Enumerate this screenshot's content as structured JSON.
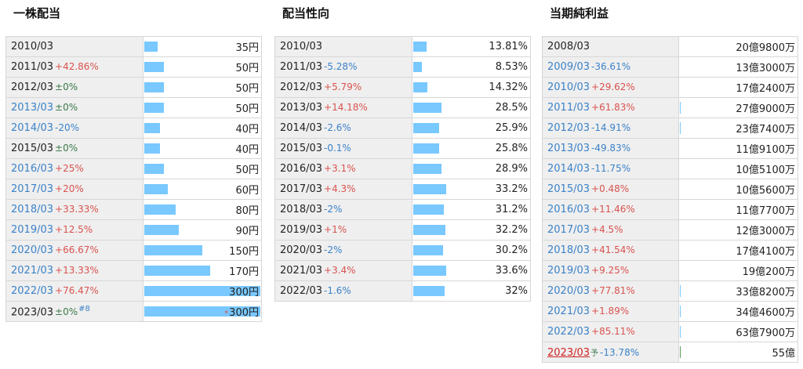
{
  "dividend": {
    "title": "一株配当",
    "rows": [
      {
        "year": "2010/03",
        "change": "",
        "dir": "",
        "value": "35円",
        "fill": 0.117,
        "link": false
      },
      {
        "year": "2011/03",
        "change": "+42.86%",
        "dir": "up",
        "value": "50円",
        "fill": 0.167,
        "link": false
      },
      {
        "year": "2012/03",
        "change": "±0%",
        "dir": "flat",
        "value": "50円",
        "fill": 0.167,
        "link": false
      },
      {
        "year": "2013/03",
        "change": "±0%",
        "dir": "flat",
        "value": "50円",
        "fill": 0.167,
        "link": true
      },
      {
        "year": "2014/03",
        "change": "-20%",
        "dir": "down",
        "value": "40円",
        "fill": 0.133,
        "link": true
      },
      {
        "year": "2015/03",
        "change": "±0%",
        "dir": "flat",
        "value": "40円",
        "fill": 0.133,
        "link": false
      },
      {
        "year": "2016/03",
        "change": "+25%",
        "dir": "up",
        "value": "50円",
        "fill": 0.167,
        "link": true
      },
      {
        "year": "2017/03",
        "change": "+20%",
        "dir": "up",
        "value": "60円",
        "fill": 0.2,
        "link": true
      },
      {
        "year": "2018/03",
        "change": "+33.33%",
        "dir": "up",
        "value": "80円",
        "fill": 0.267,
        "link": true
      },
      {
        "year": "2019/03",
        "change": "+12.5%",
        "dir": "up",
        "value": "90円",
        "fill": 0.3,
        "link": true
      },
      {
        "year": "2020/03",
        "change": "+66.67%",
        "dir": "up",
        "value": "150円",
        "fill": 0.5,
        "link": true
      },
      {
        "year": "2021/03",
        "change": "+13.33%",
        "dir": "up",
        "value": "170円",
        "fill": 0.567,
        "link": true
      },
      {
        "year": "2022/03",
        "change": "+76.47%",
        "dir": "up",
        "value": "300円",
        "fill": 1.0,
        "link": true
      },
      {
        "year": "2023/03",
        "change": "±0%",
        "dir": "flat",
        "value": "300円",
        "fill": 1.0,
        "link": false,
        "note": "#8",
        "asterisk": "*"
      }
    ]
  },
  "payout": {
    "title": "配当性向",
    "rows": [
      {
        "year": "2010/03",
        "change": "",
        "dir": "",
        "value": "13.81%",
        "fill": 0.138
      },
      {
        "year": "2011/03",
        "change": "-5.28%",
        "dir": "down",
        "value": "8.53%",
        "fill": 0.085
      },
      {
        "year": "2012/03",
        "change": "+5.79%",
        "dir": "up",
        "value": "14.32%",
        "fill": 0.143
      },
      {
        "year": "2013/03",
        "change": "+14.18%",
        "dir": "up",
        "value": "28.5%",
        "fill": 0.285
      },
      {
        "year": "2014/03",
        "change": "-2.6%",
        "dir": "down",
        "value": "25.9%",
        "fill": 0.259
      },
      {
        "year": "2015/03",
        "change": "-0.1%",
        "dir": "down",
        "value": "25.8%",
        "fill": 0.258
      },
      {
        "year": "2016/03",
        "change": "+3.1%",
        "dir": "up",
        "value": "28.9%",
        "fill": 0.289
      },
      {
        "year": "2017/03",
        "change": "+4.3%",
        "dir": "up",
        "value": "33.2%",
        "fill": 0.332
      },
      {
        "year": "2018/03",
        "change": "-2%",
        "dir": "down",
        "value": "31.2%",
        "fill": 0.312
      },
      {
        "year": "2019/03",
        "change": "+1%",
        "dir": "up",
        "value": "32.2%",
        "fill": 0.322
      },
      {
        "year": "2020/03",
        "change": "-2%",
        "dir": "down",
        "value": "30.2%",
        "fill": 0.302
      },
      {
        "year": "2021/03",
        "change": "+3.4%",
        "dir": "up",
        "value": "33.6%",
        "fill": 0.336
      },
      {
        "year": "2022/03",
        "change": "-1.6%",
        "dir": "down",
        "value": "32%",
        "fill": 0.32
      }
    ]
  },
  "profit": {
    "title": "当期純利益",
    "forecast_mark": "予",
    "rows": [
      {
        "year": "2008/03",
        "change": "",
        "dir": "",
        "value": "20億9800万",
        "link": false,
        "tick": false
      },
      {
        "year": "2009/03",
        "change": "-36.61%",
        "dir": "down",
        "value": "13億3000万",
        "link": true,
        "tick": false
      },
      {
        "year": "2010/03",
        "change": "+29.62%",
        "dir": "up",
        "value": "17億2400万",
        "link": true,
        "tick": false
      },
      {
        "year": "2011/03",
        "change": "+61.83%",
        "dir": "up",
        "value": "27億9000万",
        "link": true,
        "tick": true
      },
      {
        "year": "2012/03",
        "change": "-14.91%",
        "dir": "down",
        "value": "23億7400万",
        "link": true,
        "tick": true
      },
      {
        "year": "2013/03",
        "change": "-49.83%",
        "dir": "down",
        "value": "11億9100万",
        "link": true,
        "tick": false
      },
      {
        "year": "2014/03",
        "change": "-11.75%",
        "dir": "down",
        "value": "10億5100万",
        "link": true,
        "tick": false
      },
      {
        "year": "2015/03",
        "change": "+0.48%",
        "dir": "up",
        "value": "10億5600万",
        "link": true,
        "tick": false
      },
      {
        "year": "2016/03",
        "change": "+11.46%",
        "dir": "up",
        "value": "11億7700万",
        "link": true,
        "tick": false
      },
      {
        "year": "2017/03",
        "change": "+4.5%",
        "dir": "up",
        "value": "12億3000万",
        "link": true,
        "tick": false
      },
      {
        "year": "2018/03",
        "change": "+41.54%",
        "dir": "up",
        "value": "17億4100万",
        "link": true,
        "tick": false
      },
      {
        "year": "2019/03",
        "change": "+9.25%",
        "dir": "up",
        "value": "19億200万",
        "link": true,
        "tick": false
      },
      {
        "year": "2020/03",
        "change": "+77.81%",
        "dir": "up",
        "value": "33億8200万",
        "link": true,
        "tick": true
      },
      {
        "year": "2021/03",
        "change": "+1.89%",
        "dir": "up",
        "value": "34億4600万",
        "link": true,
        "tick": true
      },
      {
        "year": "2022/03",
        "change": "+85.11%",
        "dir": "up",
        "value": "63億7900万",
        "link": true,
        "tick": true
      },
      {
        "year": "2023/03",
        "change": "-13.78%",
        "dir": "down",
        "value": "55億",
        "link": false,
        "forecast": true,
        "tick": true,
        "tick_color": "green"
      }
    ]
  },
  "colors": {
    "bar": "#79c8ff",
    "up": "#d9534f",
    "down": "#3b82c8",
    "flat": "#3c7a4a",
    "link": "#3b82c8",
    "forecast_year": "#d02222"
  }
}
